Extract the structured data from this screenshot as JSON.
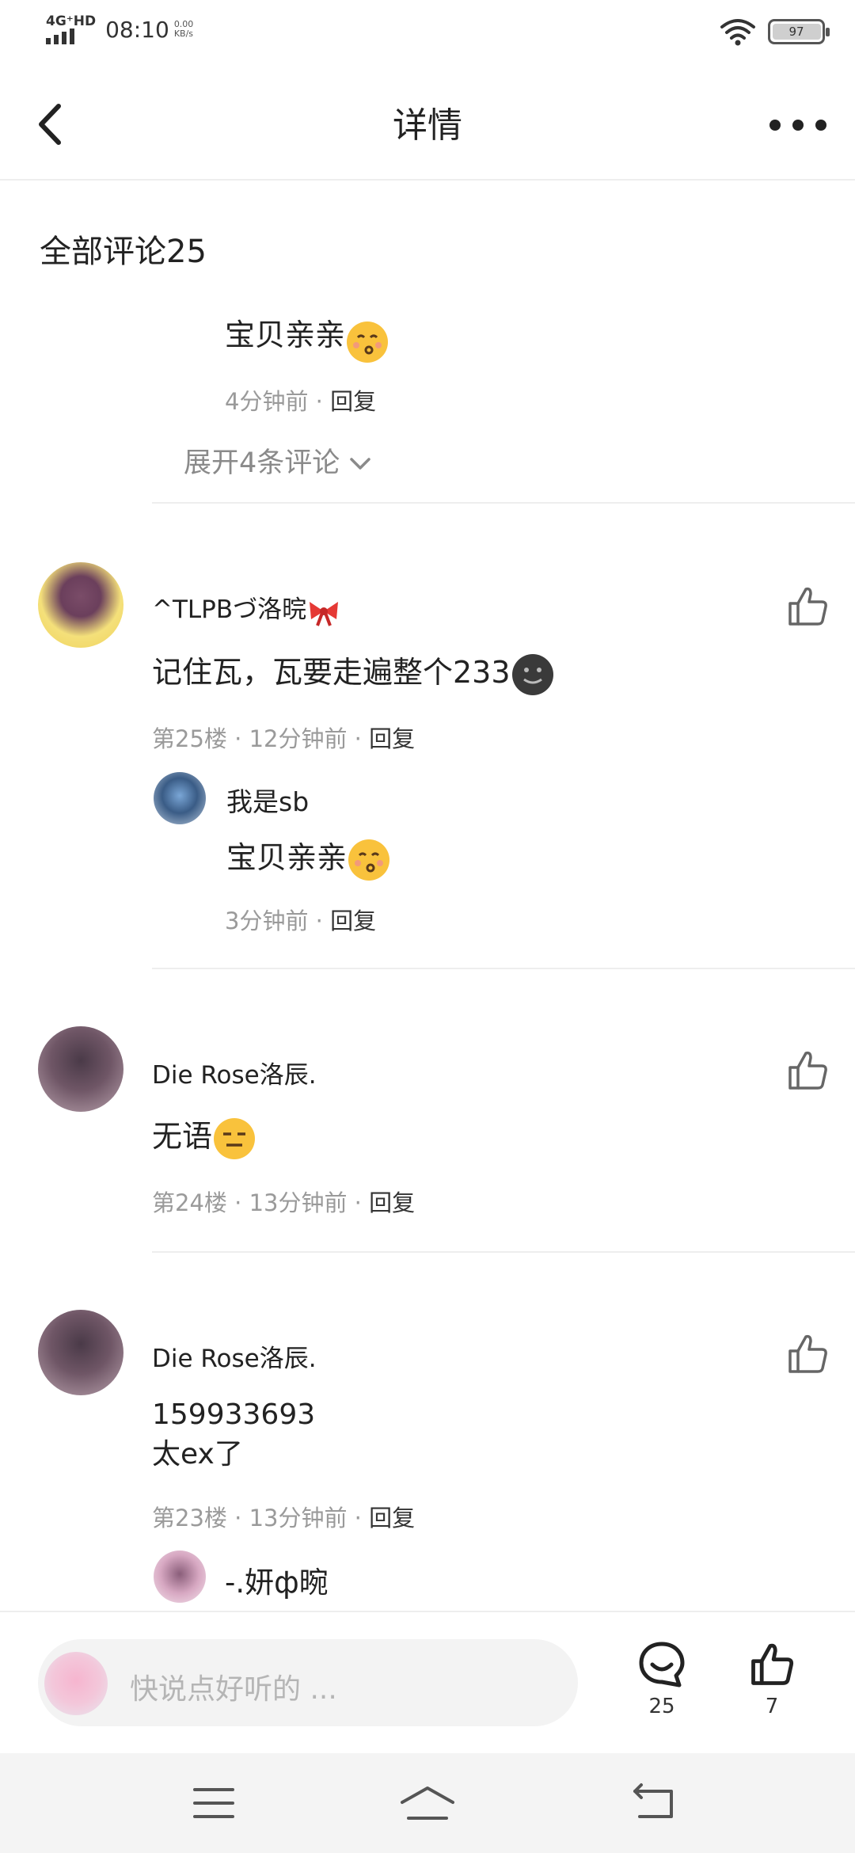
{
  "status_bar": {
    "network": "4G⁺HD",
    "time": "08:10",
    "speed_value": "0.00",
    "speed_unit": "KB/s",
    "battery": "97"
  },
  "nav": {
    "title": "详情"
  },
  "comments_header": "全部评论25",
  "prev_reply": {
    "text": "宝贝亲亲",
    "time": "4分钟前",
    "reply_label": "回复",
    "expand_label": "展开4条评论"
  },
  "comments": [
    {
      "username": "^TLPBづ洛晥",
      "text": "记住瓦，瓦要走遍整个233",
      "floor": "第25楼",
      "time": "12分钟前",
      "reply_label": "回复",
      "reply": {
        "username": "我是sb",
        "text": "宝贝亲亲",
        "time": "3分钟前",
        "reply_label": "回复"
      }
    },
    {
      "username": "Die Rose洛辰.",
      "text": "无语",
      "floor": "第24楼",
      "time": "13分钟前",
      "reply_label": "回复"
    },
    {
      "username": "Die Rose洛辰.",
      "text_line1": "159933693",
      "text_line2": "太ex了",
      "floor": "第23楼",
      "time": "13分钟前",
      "reply_label": "回复",
      "reply": {
        "username": "-.妍ф晼"
      }
    }
  ],
  "bottom_bar": {
    "placeholder": "快说点好听的 ...",
    "comment_count": "25",
    "like_count": "7"
  },
  "icons": {
    "back": "chevron-left-icon",
    "more": "more-dots-icon",
    "like": "thumbs-up-icon",
    "comment": "comment-bubble-icon",
    "menu": "menu-icon",
    "home": "home-icon",
    "return": "return-icon"
  }
}
